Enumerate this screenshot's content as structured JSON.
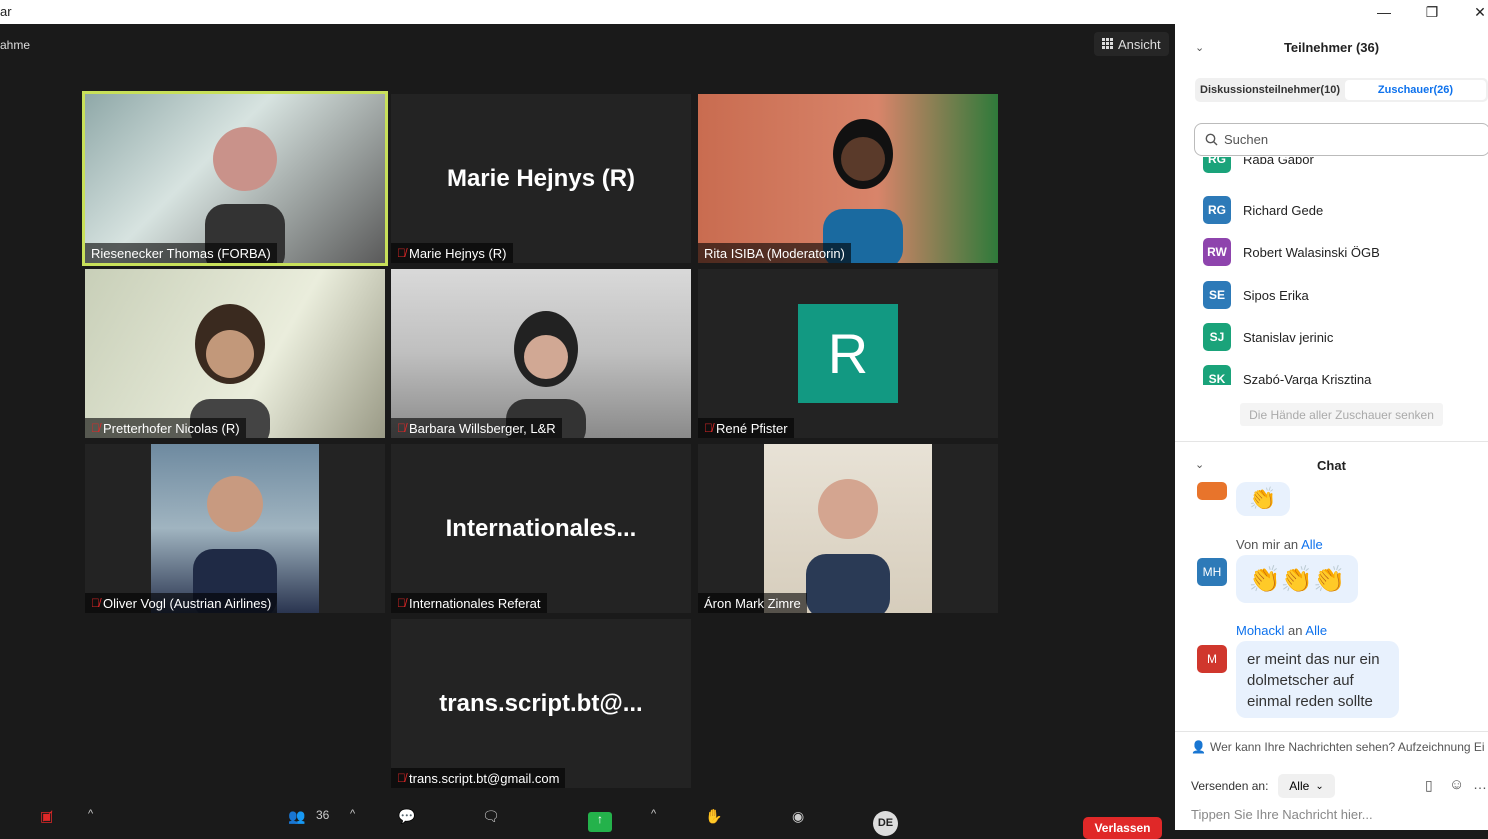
{
  "window": {
    "title": "ar",
    "min": "—",
    "max": "❐",
    "close": "✕"
  },
  "meeting": {
    "subtitle": "ahme",
    "view_label": "Ansicht"
  },
  "tiles": [
    {
      "name": "Riesenecker Thomas (FORBA)",
      "big": "",
      "muted": false
    },
    {
      "name": "Marie Hejnys (R)",
      "big": "Marie Hejnys (R)",
      "muted": true
    },
    {
      "name": "Rita ISIBA (Moderatorin)",
      "big": "",
      "muted": false
    },
    {
      "name": "Pretterhofer Nicolas (R)",
      "big": "",
      "muted": true
    },
    {
      "name": "Barbara Willsberger, L&R",
      "big": "",
      "muted": true
    },
    {
      "name": "René Pfister",
      "big": "",
      "muted": true,
      "avatar_letter": "R"
    },
    {
      "name": "Oliver Vogl (Austrian Airlines)",
      "big": "",
      "muted": true
    },
    {
      "name": "Internationales Referat",
      "big": "Internationales...",
      "muted": true
    },
    {
      "name": "Áron Mark Zimre",
      "big": "",
      "muted": false
    },
    {
      "name": "trans.script.bt@gmail.com",
      "big": "trans.script.bt@...",
      "muted": true
    }
  ],
  "toolbar": {
    "participants_count": "36",
    "leave": "Verlassen",
    "lang": "DE"
  },
  "panel": {
    "participants_title": "Teilnehmer (36)",
    "tab_panelists": "Diskussionsteilnehmer(10)",
    "tab_attendees": "Zuschauer(26)",
    "search_placeholder": "Suchen",
    "participants": [
      {
        "initials": "RG",
        "name": "Rába Gábor",
        "color": "#1aa37a"
      },
      {
        "initials": "RG",
        "name": "Richard Gede",
        "color": "#2d7ab8"
      },
      {
        "initials": "RW",
        "name": "Robert Walasinski ÖGB",
        "color": "#8e44ad"
      },
      {
        "initials": "SE",
        "name": "Sipos Erika",
        "color": "#2d7ab8"
      },
      {
        "initials": "SJ",
        "name": "Stanislav jerinic",
        "color": "#1aa37a"
      },
      {
        "initials": "SK",
        "name": "Szabó-Varga Krisztina",
        "color": "#1aa37a"
      }
    ],
    "lower_hands": "Die Hände aller Zuschauer senken",
    "chat_title": "Chat",
    "messages": [
      {
        "from": "Von mir",
        "to_word": "an",
        "to": "Alle",
        "initials": "MH",
        "emoji": "👏👏👏"
      },
      {
        "from": "Mohackl",
        "to_word": "an",
        "to": "Alle",
        "initials": "M",
        "text": "er meint das nur ein dolmetscher auf einmal reden sollte"
      }
    ],
    "privacy_text": "Wer kann Ihre Nachrichten sehen? Aufzeichnung Ei",
    "send_to_label": "Versenden an:",
    "send_to_value": "Alle",
    "chat_placeholder": "Tippen Sie Ihre Nachricht hier..."
  }
}
